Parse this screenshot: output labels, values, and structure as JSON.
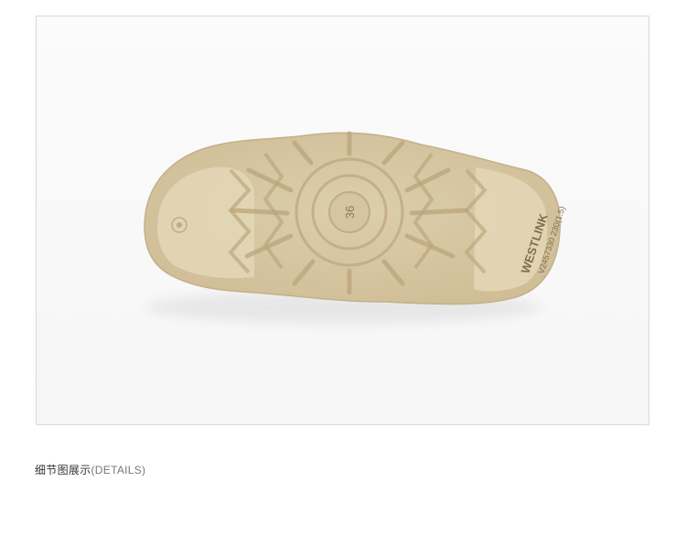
{
  "product_image": {
    "sole_brand_text": "WESTLINK",
    "sole_code_text": "V2457330 230(1.5)",
    "sole_size_text": "36",
    "sole_color": "#d9c9a6"
  },
  "caption": {
    "title_cn": "细节图展示",
    "title_en": "(DETAILS)"
  }
}
